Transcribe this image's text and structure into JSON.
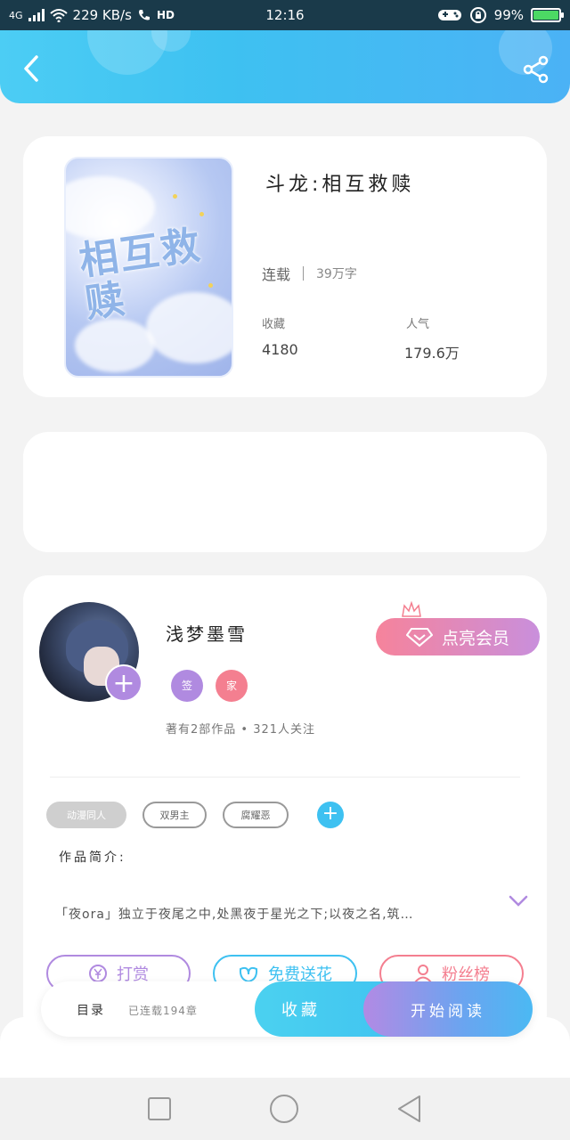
{
  "status_bar": {
    "network": "4G",
    "speed": "229 KB/s",
    "hd": "HD",
    "time": "12:16",
    "battery": "99%",
    "battery_level": 0.99,
    "battery_color": "#4cd964"
  },
  "header": {
    "back_icon": "chevron-left-icon",
    "share_icon": "share-icon",
    "gradient_start": "#4ccdf4",
    "gradient_end": "#4bb2f5"
  },
  "book": {
    "cover_title": "相互救赎",
    "title": "斗龙:相互救赎",
    "status": "连载",
    "word_count": "39万字",
    "favorites_label": "收藏",
    "favorites_value": "4180",
    "popularity_label": "人气",
    "popularity_value": "179.6万"
  },
  "author": {
    "name": "浅梦墨雪",
    "badge_signed": "签",
    "badge_family": "家",
    "meta": "著有2部作品 • 321人关注",
    "vip_button": "点亮会员",
    "follow_symbol": "+"
  },
  "tags": [
    "动漫同人",
    "双男主",
    "腐耀恶"
  ],
  "tag_add_symbol": "+",
  "intro": {
    "label": "作品简介:",
    "text": "「夜ora」独立于夜尾之中,处黑夜于星光之下;以夜之名,筑…"
  },
  "actions": {
    "tip": "打赏",
    "flower": "免费送花",
    "fans": "粉丝榜"
  },
  "bottom_bar": {
    "toc": "目录",
    "chapters": "已连载194章",
    "collect": "收藏",
    "read": "开始阅读"
  },
  "colors": {
    "accent_blue": "#3ec1f1",
    "accent_purple": "#b08ae0",
    "accent_pink": "#f47f90"
  }
}
